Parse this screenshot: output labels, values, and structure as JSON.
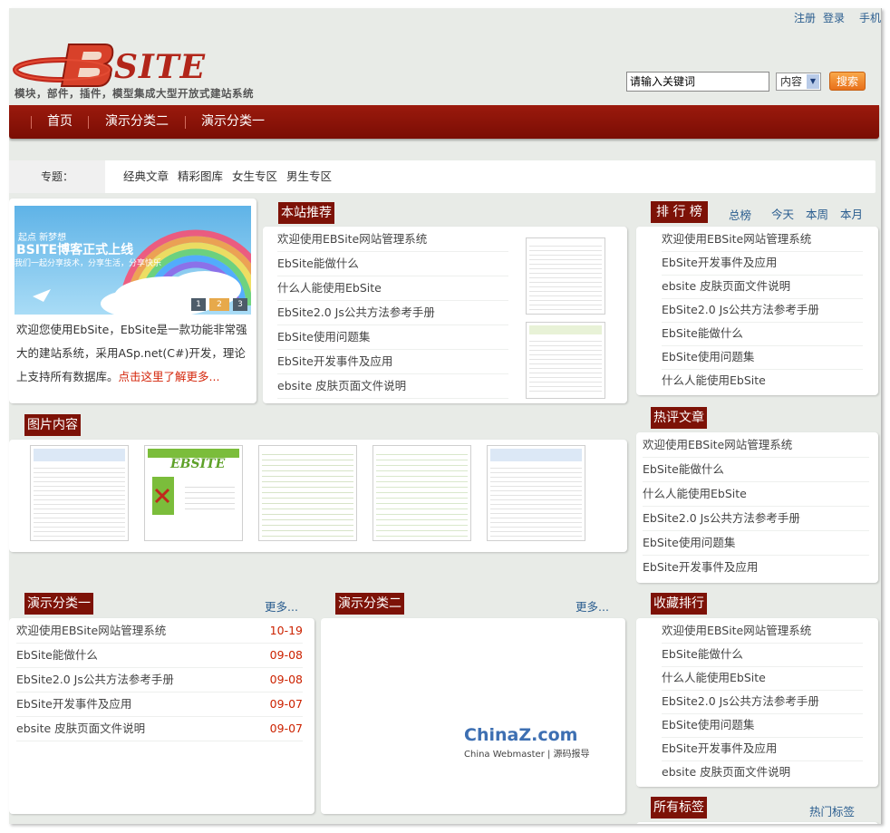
{
  "header": {
    "links": [
      "注册",
      "登录",
      "手机"
    ],
    "logo_text": "SITE",
    "slogan": "模块，部件，插件，模型集成大型开放式建站系统",
    "search_value": "请输入关键词",
    "search_scope": "内容",
    "search_button": "搜索"
  },
  "nav": [
    "首页",
    "演示分类二",
    "演示分类一"
  ],
  "topics": {
    "label": "专题：",
    "items": [
      "经典文章",
      "精彩图库",
      "女生专区",
      "男生专区"
    ]
  },
  "intro": {
    "banner_small": "起点 新梦想",
    "banner_big": "BSITE博客正式上线",
    "banner_sub": "我们一起分享技术，分享生活，分享快乐",
    "banner_pages": [
      "1",
      "2",
      "3"
    ],
    "text": "欢迎您使用EbSite，EbSite是一款功能非常强大的建站系统，采用ASp.net(C#)开发，理论上支持所有数据库。",
    "link": "点击这里了解更多..."
  },
  "recommend": {
    "title": "本站推荐",
    "items": [
      "欢迎使用EBSite网站管理系统",
      "EbSite能做什么",
      "什么人能使用EbSite",
      "EbSite2.0 Js公共方法参考手册",
      "EbSite使用问题集",
      "EbSite开发事件及应用",
      "ebsite 皮肤页面文件说明"
    ]
  },
  "ranking": {
    "title": "排 行 榜",
    "tabs": [
      "总榜",
      "今天",
      "本周",
      "本月"
    ],
    "items": [
      "欢迎使用EBSite网站管理系统",
      "EbSite开发事件及应用",
      "ebsite 皮肤页面文件说明",
      "EbSite2.0 Js公共方法参考手册",
      "EbSite能做什么",
      "EbSite使用问题集",
      "什么人能使用EbSite"
    ]
  },
  "pictures": {
    "title": "图片内容",
    "thumb_brand": "EBSITE"
  },
  "hot": {
    "title": "热评文章",
    "items": [
      "欢迎使用EBSite网站管理系统",
      "EbSite能做什么",
      "什么人能使用EbSite",
      "EbSite2.0 Js公共方法参考手册",
      "EbSite使用问题集",
      "EbSite开发事件及应用"
    ]
  },
  "cat1": {
    "title": "演示分类一",
    "more": "更多...",
    "items": [
      {
        "title": "欢迎使用EBSite网站管理系统",
        "date": "10-19"
      },
      {
        "title": "EbSite能做什么",
        "date": "09-08"
      },
      {
        "title": "EbSite2.0 Js公共方法参考手册",
        "date": "09-08"
      },
      {
        "title": "EbSite开发事件及应用",
        "date": "09-07"
      },
      {
        "title": "ebsite 皮肤页面文件说明",
        "date": "09-07"
      }
    ]
  },
  "cat2": {
    "title": "演示分类二",
    "more": "更多...",
    "watermark_main": "ChinaZ.com",
    "watermark_sub": "China Webmaster | 源码报导"
  },
  "favorite": {
    "title": "收藏排行",
    "items": [
      "欢迎使用EBSite网站管理系统",
      "EbSite能做什么",
      "什么人能使用EbSite",
      "EbSite2.0 Js公共方法参考手册",
      "EbSite使用问题集",
      "EbSite开发事件及应用",
      "ebsite 皮肤页面文件说明"
    ]
  },
  "tags": {
    "title": "所有标签",
    "hot": "热门标签"
  },
  "colors": {
    "brand_red": "#7d1207",
    "nav_red": "#8b1409",
    "link_blue": "#2a5d8f",
    "date_red": "#cc2200",
    "search_orange": "#e8701a"
  }
}
